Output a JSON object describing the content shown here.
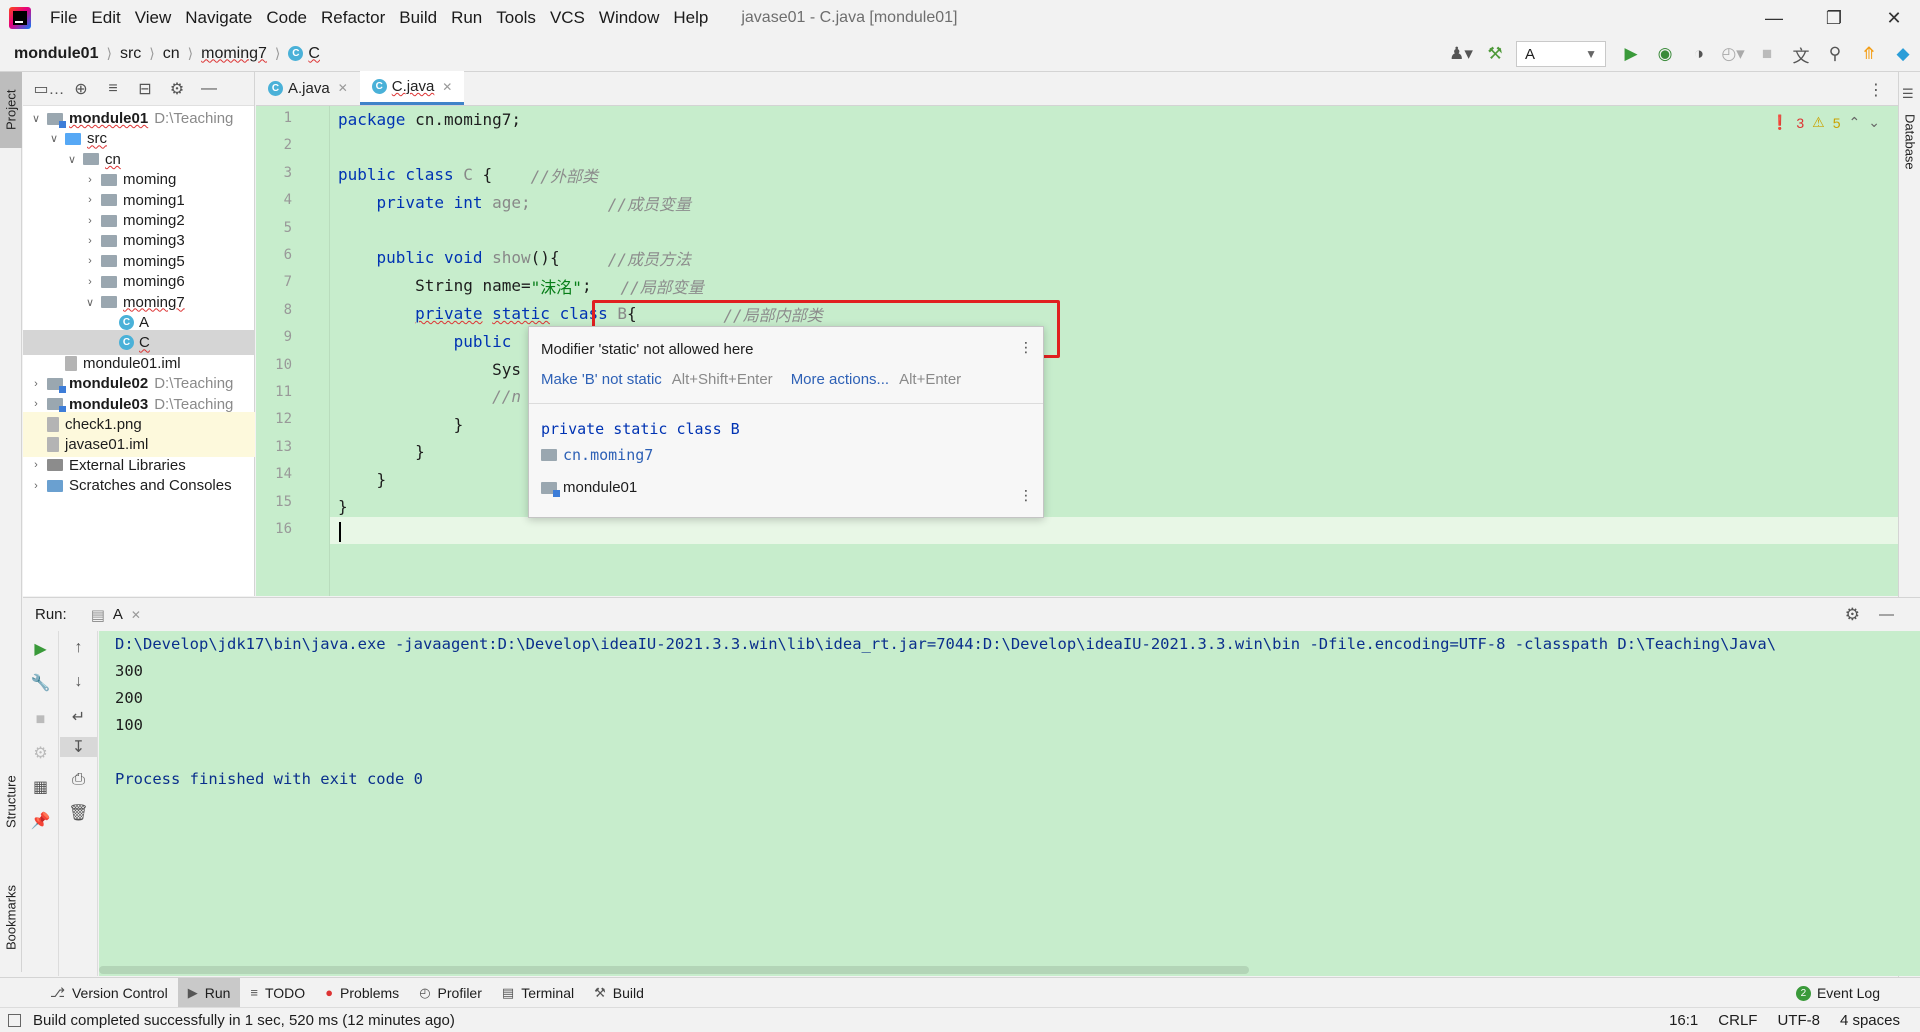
{
  "menu": {
    "items": [
      "File",
      "Edit",
      "View",
      "Navigate",
      "Code",
      "Refactor",
      "Build",
      "Run",
      "Tools",
      "VCS",
      "Window",
      "Help"
    ],
    "window_title": "javase01 - C.java [mondule01]"
  },
  "breadcrumb": [
    "mondule01",
    "src",
    "cn",
    "moming7",
    "C"
  ],
  "toolbar": {
    "run_config": "A"
  },
  "side_tabs": {
    "project": "Project",
    "structure": "Structure",
    "bookmarks": "Bookmarks",
    "database": "Database"
  },
  "project_tree": [
    {
      "label": "mondule01",
      "path": "D:\\Teaching",
      "indent": 0,
      "arrow": "v",
      "icon": "module",
      "bold": true
    },
    {
      "label": "src",
      "indent": 1,
      "arrow": "v",
      "icon": "src"
    },
    {
      "label": "cn",
      "indent": 2,
      "arrow": "v",
      "icon": "folder"
    },
    {
      "label": "moming",
      "indent": 3,
      "arrow": ">",
      "icon": "folder"
    },
    {
      "label": "moming1",
      "indent": 3,
      "arrow": ">",
      "icon": "folder"
    },
    {
      "label": "moming2",
      "indent": 3,
      "arrow": ">",
      "icon": "folder"
    },
    {
      "label": "moming3",
      "indent": 3,
      "arrow": ">",
      "icon": "folder"
    },
    {
      "label": "moming5",
      "indent": 3,
      "arrow": ">",
      "icon": "folder"
    },
    {
      "label": "moming6",
      "indent": 3,
      "arrow": ">",
      "icon": "folder"
    },
    {
      "label": "moming7",
      "indent": 3,
      "arrow": "v",
      "icon": "folder"
    },
    {
      "label": "A",
      "indent": 4,
      "arrow": "",
      "icon": "class"
    },
    {
      "label": "C",
      "indent": 4,
      "arrow": "",
      "icon": "class",
      "selected": true
    },
    {
      "label": "mondule01.iml",
      "indent": 1,
      "arrow": "",
      "icon": "file"
    },
    {
      "label": "mondule02",
      "path": "D:\\Teaching",
      "indent": 0,
      "arrow": ">",
      "icon": "module",
      "bold": true
    },
    {
      "label": "mondule03",
      "path": "D:\\Teaching",
      "indent": 0,
      "arrow": ">",
      "icon": "module",
      "bold": true
    },
    {
      "label": "check1.png",
      "indent": 0,
      "arrow": "",
      "icon": "file",
      "yellow": true
    },
    {
      "label": "javase01.iml",
      "indent": 0,
      "arrow": "",
      "icon": "file",
      "yellow": true
    },
    {
      "label": "External Libraries",
      "indent": 0,
      "arrow": ">",
      "icon": "lib"
    },
    {
      "label": "Scratches and Consoles",
      "indent": 0,
      "arrow": ">",
      "icon": "scratch"
    }
  ],
  "editor_tabs": [
    {
      "label": "A.java",
      "active": false
    },
    {
      "label": "C.java",
      "active": true
    }
  ],
  "line_numbers": [
    "1",
    "2",
    "3",
    "4",
    "5",
    "6",
    "7",
    "8",
    "9",
    "10",
    "11",
    "12",
    "13",
    "14",
    "15",
    "16"
  ],
  "code": {
    "l1_kw": "package",
    "l1_rest": " cn.moming7;",
    "l3_kw": "public class",
    "l3_name": " C ",
    "l3_brace": "{",
    "l3_cm": "//外部类",
    "l4_kw": "private int",
    "l4_name": " age;",
    "l4_cm": "//成员变量",
    "l6_kw": "public void",
    "l6_name": " show",
    "l6_rest": "(){",
    "l6_cm": "//成员方法",
    "l7_pre": "String name=",
    "l7_str": "\"沫洺\"",
    "l7_post": ";",
    "l7_cm": "//局部变量",
    "l8_kw1": "private",
    "l8_kw2": "static",
    "l8_kw3": "class",
    "l8_name": " B",
    "l8_brace": "{",
    "l8_cm": "//局部内部类",
    "l9_kw": "public",
    "l10": "Sys",
    "l11": "//n",
    "l12": "}",
    "l13": "}",
    "l14": "}",
    "l15": "}"
  },
  "inspection": {
    "errors": "3",
    "warnings": "5"
  },
  "popup": {
    "message": "Modifier 'static' not allowed here",
    "action1": "Make 'B' not static",
    "action1_key": "Alt+Shift+Enter",
    "action2": "More actions...",
    "action2_key": "Alt+Enter",
    "decl": "private static class B",
    "package": "cn.moming7",
    "module": "mondule01"
  },
  "run_panel": {
    "title": "Run:",
    "tab": "A",
    "console": [
      "D:\\Develop\\jdk17\\bin\\java.exe -javaagent:D:\\Develop\\ideaIU-2021.3.3.win\\lib\\idea_rt.jar=7044:D:\\Develop\\ideaIU-2021.3.3.win\\bin -Dfile.encoding=UTF-8 -classpath D:\\Teaching\\Java\\",
      "300",
      "200",
      "100",
      "",
      "Process finished with exit code 0"
    ]
  },
  "tool_windows": [
    "Version Control",
    "Run",
    "TODO",
    "Problems",
    "Profiler",
    "Terminal",
    "Build"
  ],
  "event_log": "Event Log",
  "status": {
    "message": "Build completed successfully in 1 sec, 520 ms (12 minutes ago)",
    "position": "16:1",
    "line_sep": "CRLF",
    "encoding": "UTF-8",
    "indent": "4 spaces"
  },
  "colors": {
    "editor_bg": "#c7edcc",
    "keyword": "#0033b3",
    "string": "#067d17",
    "error_box": "#e02020",
    "link": "#2e61b6"
  }
}
